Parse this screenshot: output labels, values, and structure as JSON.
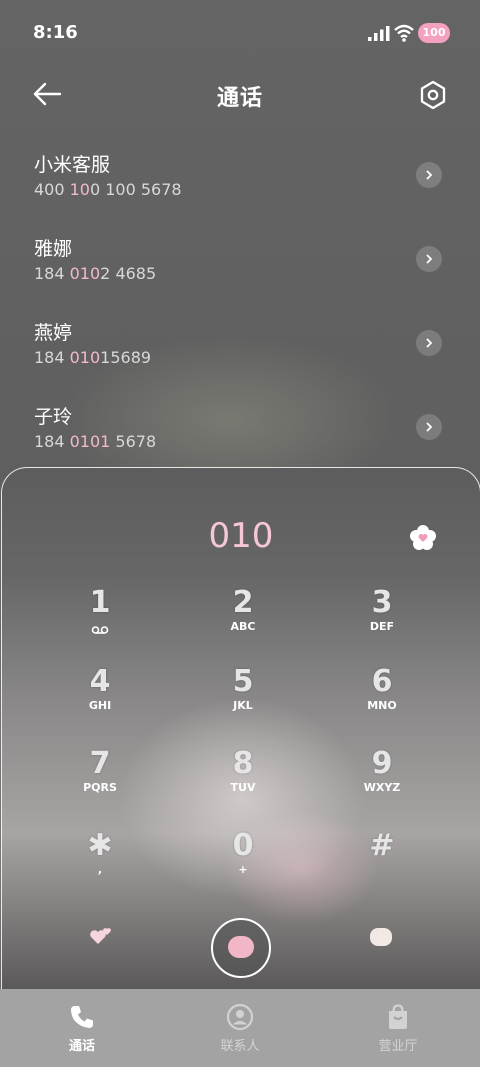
{
  "status": {
    "time": "8:16",
    "battery": "100"
  },
  "header": {
    "title": "通话"
  },
  "contacts": [
    {
      "name": "小米客服",
      "number_pre": "400 ",
      "number_hl": "10",
      "number_post": "0 100 5678"
    },
    {
      "name": "雅娜",
      "number_pre": "184 ",
      "number_hl": "010",
      "number_post": "2 4685"
    },
    {
      "name": "燕婷",
      "number_pre": "184 ",
      "number_hl": "010",
      "number_post": "15689"
    },
    {
      "name": "子玲",
      "number_pre": "184 ",
      "number_hl": "0101",
      "number_post": " 5678"
    }
  ],
  "dialer": {
    "input": "010",
    "keys": [
      {
        "digit": "1",
        "letters": ""
      },
      {
        "digit": "2",
        "letters": "ABC"
      },
      {
        "digit": "3",
        "letters": "DEF"
      },
      {
        "digit": "4",
        "letters": "GHI"
      },
      {
        "digit": "5",
        "letters": "JKL"
      },
      {
        "digit": "6",
        "letters": "MNO"
      },
      {
        "digit": "7",
        "letters": "PQRS"
      },
      {
        "digit": "8",
        "letters": "TUV"
      },
      {
        "digit": "9",
        "letters": "WXYZ"
      },
      {
        "digit": "✱",
        "letters": ","
      },
      {
        "digit": "0",
        "letters": "+"
      },
      {
        "digit": "#",
        "letters": ""
      }
    ]
  },
  "tabs": [
    {
      "label": "通话",
      "icon": "phone-icon",
      "active": true
    },
    {
      "label": "联系人",
      "icon": "person-icon",
      "active": false
    },
    {
      "label": "营业厅",
      "icon": "bag-icon",
      "active": false
    }
  ],
  "colors": {
    "highlight": "#f2b9c9",
    "dial_digits": "#f6c7d4",
    "tabbar": "#a3a3a3"
  }
}
